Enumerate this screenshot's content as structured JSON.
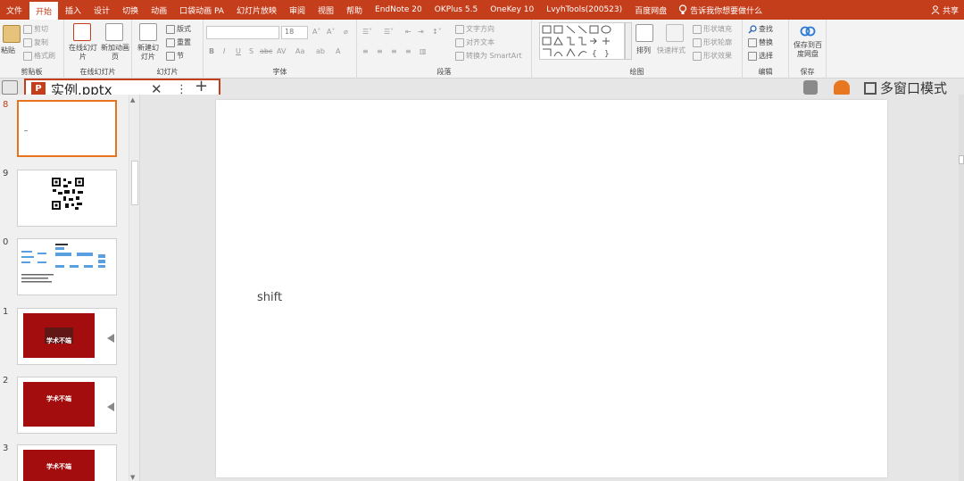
{
  "menu": {
    "items": [
      "文件",
      "开始",
      "插入",
      "设计",
      "切换",
      "动画",
      "口袋动画 PA",
      "幻灯片放映",
      "审阅",
      "视图",
      "帮助",
      "EndNote 20",
      "OKPlus 5.5",
      "OneKey 10",
      "LvyhTools(200523)",
      "百度网盘"
    ],
    "active": "开始",
    "tell_me": "告诉我你想要做什么",
    "share": "共享"
  },
  "ribbon": {
    "clipboard": {
      "paste": "粘贴",
      "cut": "剪切",
      "copy": "复制",
      "format_painter": "格式刷",
      "label": "剪贴板"
    },
    "online": {
      "online_slide": "在线幻灯片",
      "new_anim": "新加动画页",
      "label": "在线幻灯片"
    },
    "slides": {
      "new_slide": "新建幻灯片",
      "layout": "版式",
      "reset": "重置",
      "section": "节",
      "label": "幻灯片"
    },
    "font": {
      "size": "18",
      "label": "字体",
      "bold": "B",
      "italic": "I",
      "underline": "U",
      "strike": "S",
      "shadow": "abc",
      "spacing": "AV",
      "case": "Aa",
      "color": "A"
    },
    "paragraph": {
      "text_dir": "文字方向",
      "align_text": "对齐文本",
      "smartart": "转换为 SmartArt",
      "label": "段落"
    },
    "drawing": {
      "arrange": "排列",
      "quick_styles": "快速样式",
      "shape_fill": "形状填充",
      "shape_outline": "形状轮廓",
      "shape_effect": "形状效果",
      "label": "绘图"
    },
    "editing": {
      "find": "查找",
      "replace": "替换",
      "select": "选择",
      "label": "编辑"
    },
    "save": {
      "save_baidu": "保存到百度网盘",
      "label": "保存"
    }
  },
  "document": {
    "tab_name": "实例.pptx",
    "multi_window": "多窗口模式"
  },
  "thumbnails": [
    {
      "num": "8",
      "type": "blank",
      "selected": true
    },
    {
      "num": "9",
      "type": "qr",
      "selected": false
    },
    {
      "num": "0",
      "type": "diagram",
      "selected": false
    },
    {
      "num": "1",
      "type": "red",
      "text": "学术不端",
      "selected": false
    },
    {
      "num": "2",
      "type": "red",
      "text": "学术不端",
      "selected": false
    },
    {
      "num": "3",
      "type": "red",
      "text": "学术不端",
      "selected": false
    }
  ],
  "slide": {
    "text": "shift"
  },
  "colors": {
    "brand": "#c43e1c",
    "selected_thumb": "#e8731f",
    "red_slide": "#a30d0d"
  }
}
